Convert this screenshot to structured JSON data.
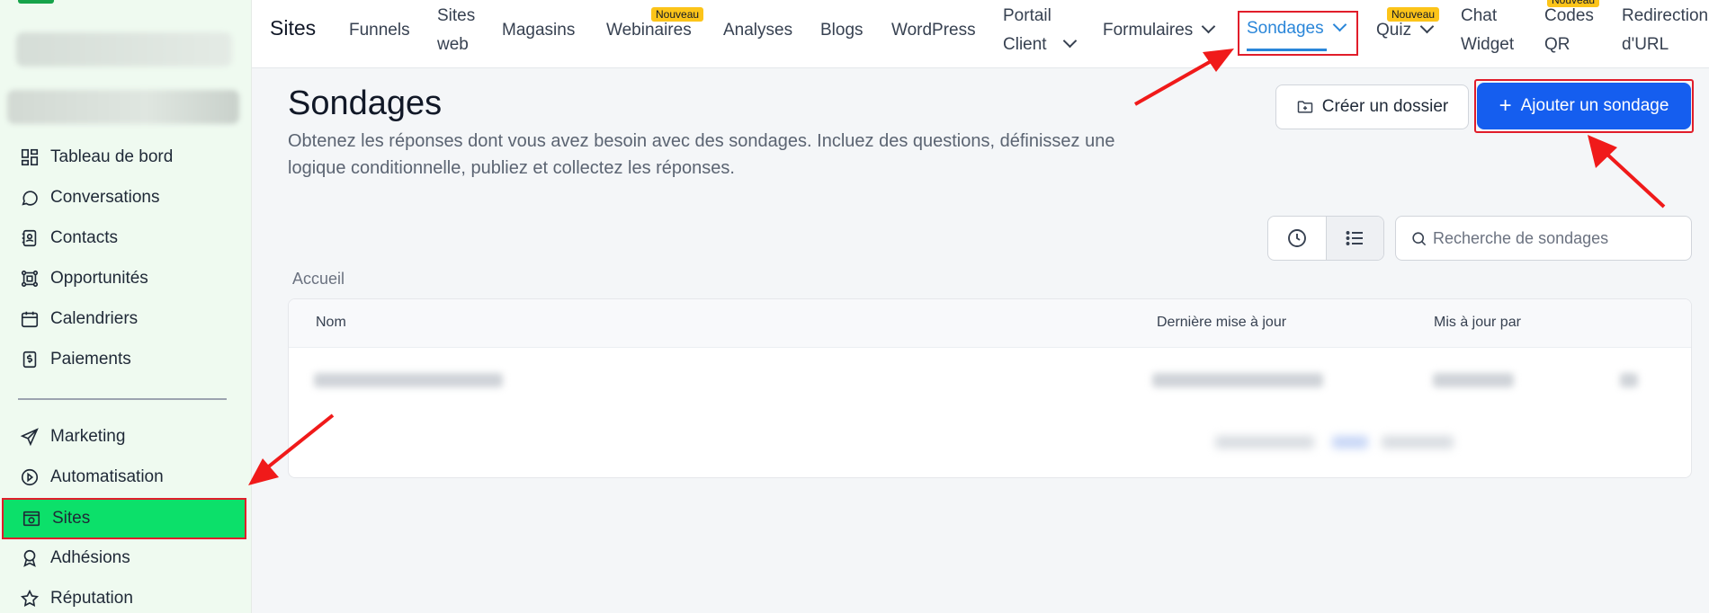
{
  "sidebar": {
    "items": [
      {
        "label": "Tableau de bord",
        "icon": "dashboard-icon"
      },
      {
        "label": "Conversations",
        "icon": "chat-bubble-icon"
      },
      {
        "label": "Contacts",
        "icon": "contact-book-icon"
      },
      {
        "label": "Opportunités",
        "icon": "opportunities-icon"
      },
      {
        "label": "Calendriers",
        "icon": "calendar-icon"
      },
      {
        "label": "Paiements",
        "icon": "payment-icon"
      },
      {
        "label": "Marketing",
        "icon": "send-icon"
      },
      {
        "label": "Automatisation",
        "icon": "automation-icon"
      },
      {
        "label": "Sites",
        "icon": "sites-icon"
      },
      {
        "label": "Adhésions",
        "icon": "membership-badge-icon"
      },
      {
        "label": "Réputation",
        "icon": "star-icon"
      }
    ],
    "active": "Sites"
  },
  "topbar": {
    "title": "Sites",
    "tabs": [
      {
        "label": "Funnels"
      },
      {
        "label_line1": "Sites",
        "label_line2": "web"
      },
      {
        "label": "Magasins"
      },
      {
        "label": "Webinaires",
        "badge": "Nouveau"
      },
      {
        "label": "Analyses"
      },
      {
        "label": "Blogs"
      },
      {
        "label": "WordPress"
      },
      {
        "label_line1": "Portail",
        "label_line2": "Client"
      },
      {
        "label": "Formulaires"
      },
      {
        "label": "Sondages"
      },
      {
        "label": "Quiz",
        "badge": "Nouveau"
      },
      {
        "label_line1": "Chat",
        "label_line2": "Widget"
      },
      {
        "label_line1": "Codes",
        "label_line2": "QR",
        "badge": "Nouveau"
      },
      {
        "label_line1": "Redirection",
        "label_line2": "d'URL"
      }
    ]
  },
  "main": {
    "title": "Sondages",
    "description": "Obtenez les réponses dont vous avez besoin avec des sondages. Incluez des questions, définissez une logique conditionnelle, publiez et collectez les réponses.",
    "create_folder_label": "Créer un dossier",
    "add_survey_label": "Ajouter un sondage",
    "search_placeholder": "Recherche de sondages",
    "breadcrumb": "Accueil",
    "table": {
      "columns": [
        "Nom",
        "Dernière mise à jour",
        "Mis à jour par"
      ]
    }
  },
  "colors": {
    "sidebar_bg": "#effaf0",
    "active_nav": "#0ce06a",
    "primary": "#155eef",
    "tab_active": "#2a86d9",
    "highlight": "#e11d2a",
    "badge": "#fcc419"
  }
}
